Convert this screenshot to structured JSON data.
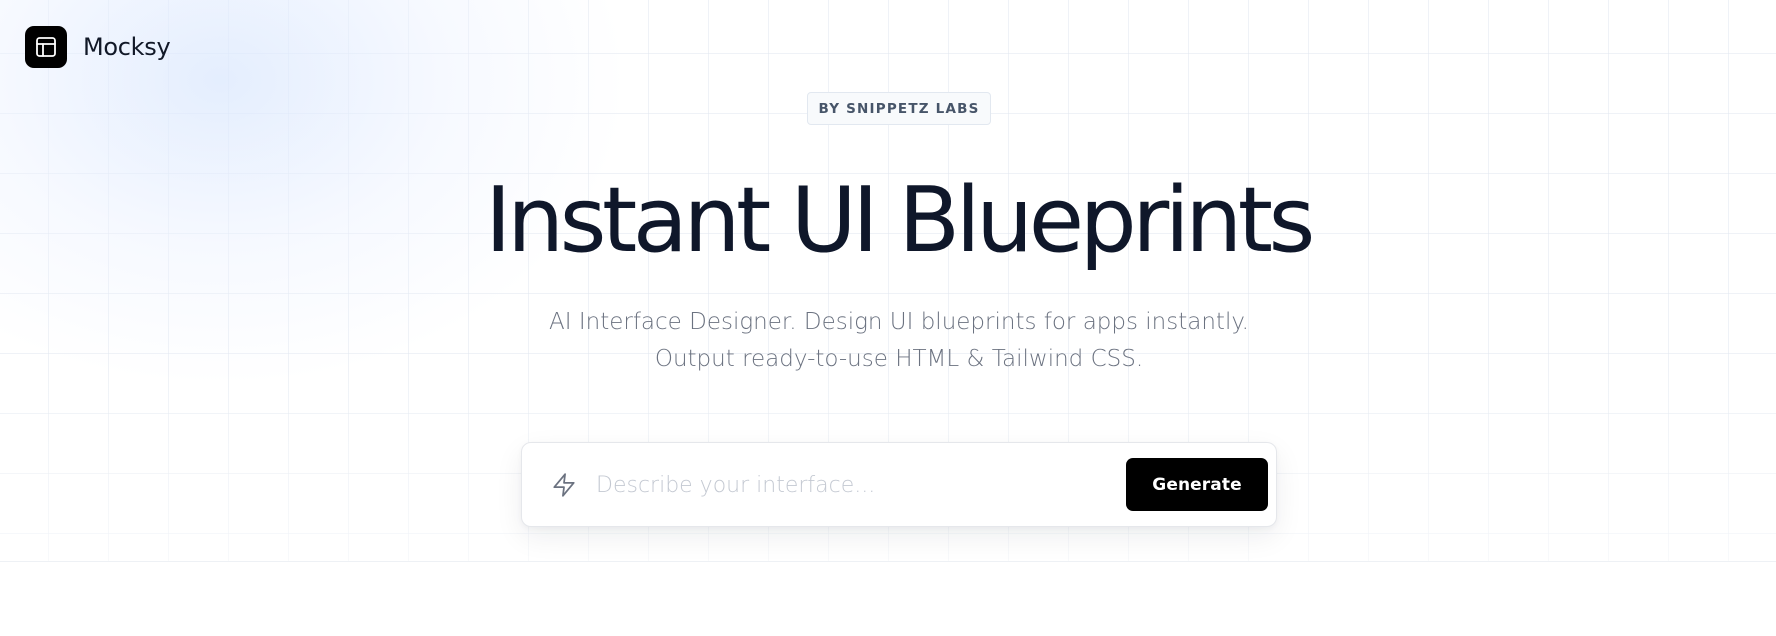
{
  "brand": {
    "name": "Mocksy",
    "logo_icon": "layout-template-icon"
  },
  "hero": {
    "badge": "BY SNIPPETZ LABS",
    "title": "Instant UI Blueprints",
    "subtitle": "AI Interface Designer. Design UI blueprints for apps instantly. Output ready-to-use HTML & Tailwind CSS."
  },
  "prompt": {
    "icon": "lightning-bolt-icon",
    "placeholder": "Describe your interface...",
    "value": "",
    "button_label": "Generate"
  },
  "colors": {
    "primary": "#000000",
    "heading": "#0f172a",
    "muted": "#6b7280",
    "badge_text": "#475569",
    "grid_line": "#e2e8f0"
  }
}
